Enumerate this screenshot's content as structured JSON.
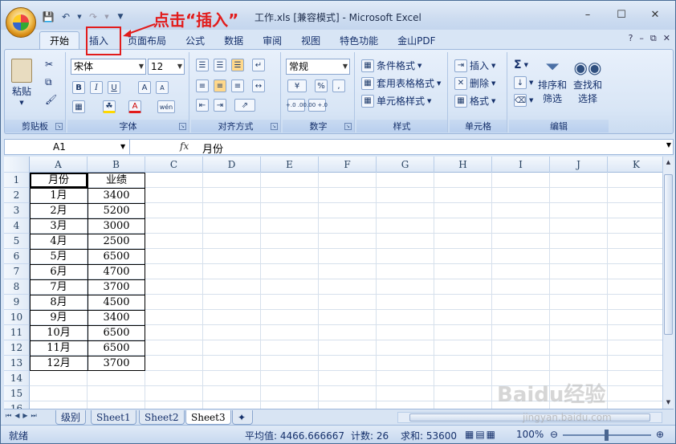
{
  "window": {
    "title": "工作.xls  [兼容模式] - Microsoft Excel",
    "controls": [
      "–",
      "☐",
      "✕"
    ]
  },
  "annotation": {
    "text": "点击“插入”"
  },
  "ribbon_tabs": [
    {
      "label": "开始",
      "active": true
    },
    {
      "label": "插入"
    },
    {
      "label": "页面布局"
    },
    {
      "label": "公式"
    },
    {
      "label": "数据"
    },
    {
      "label": "审阅"
    },
    {
      "label": "视图"
    },
    {
      "label": "特色功能"
    },
    {
      "label": "金山PDF"
    }
  ],
  "ribbon": {
    "clipboard": {
      "label": "剪贴板",
      "paste": "粘贴"
    },
    "font": {
      "label": "字体",
      "name": "宋体",
      "size": "12",
      "bold": "B",
      "italic": "I",
      "underline": "U",
      "grow": "A",
      "shrink": "A",
      "font_color": "A",
      "wen": "wén"
    },
    "alignment": {
      "label": "对齐方式"
    },
    "number": {
      "label": "数字",
      "format": "常规",
      "percent": "%",
      "comma": ",",
      "inc_decimal": "+.0 .00",
      "dec_decimal": ".00 +.0"
    },
    "styles": {
      "label": "样式",
      "conditional": "条件格式",
      "table": "套用表格格式",
      "cell": "单元格样式"
    },
    "cells": {
      "label": "单元格",
      "insert": "插入",
      "delete": "删除",
      "format": "格式"
    },
    "editing": {
      "label": "编辑",
      "sum": "Σ",
      "sort": "排序和\n筛选",
      "sort1": "排序和",
      "sort2": "筛选",
      "find1": "查找和",
      "find2": "选择"
    }
  },
  "formula_bar": {
    "cell_ref": "A1",
    "fx": "fx",
    "content": "月份"
  },
  "columns": [
    "A",
    "B",
    "C",
    "D",
    "E",
    "F",
    "G",
    "H",
    "I",
    "J",
    "K"
  ],
  "rows": [
    "1",
    "2",
    "3",
    "4",
    "5",
    "6",
    "7",
    "8",
    "9",
    "10",
    "11",
    "12",
    "13",
    "14",
    "15",
    "16"
  ],
  "table": {
    "header": [
      "月份",
      "业绩"
    ],
    "data": [
      [
        "1月",
        "3400"
      ],
      [
        "2月",
        "5200"
      ],
      [
        "3月",
        "3000"
      ],
      [
        "4月",
        "2500"
      ],
      [
        "5月",
        "6500"
      ],
      [
        "6月",
        "4700"
      ],
      [
        "7月",
        "3700"
      ],
      [
        "8月",
        "4500"
      ],
      [
        "9月",
        "3400"
      ],
      [
        "10月",
        "6500"
      ],
      [
        "11月",
        "6500"
      ],
      [
        "12月",
        "3700"
      ]
    ]
  },
  "sheets": [
    {
      "label": "级别"
    },
    {
      "label": "Sheet1"
    },
    {
      "label": "Sheet2"
    },
    {
      "label": "Sheet3",
      "active": true
    }
  ],
  "status": {
    "mode": "就绪",
    "average": "平均值: 4466.666667",
    "count": "计数: 26",
    "sum": "求和: 53600",
    "zoom": "100%"
  },
  "watermark": {
    "brand": "Baidu经验",
    "url": "jingyan.baidu.com"
  }
}
